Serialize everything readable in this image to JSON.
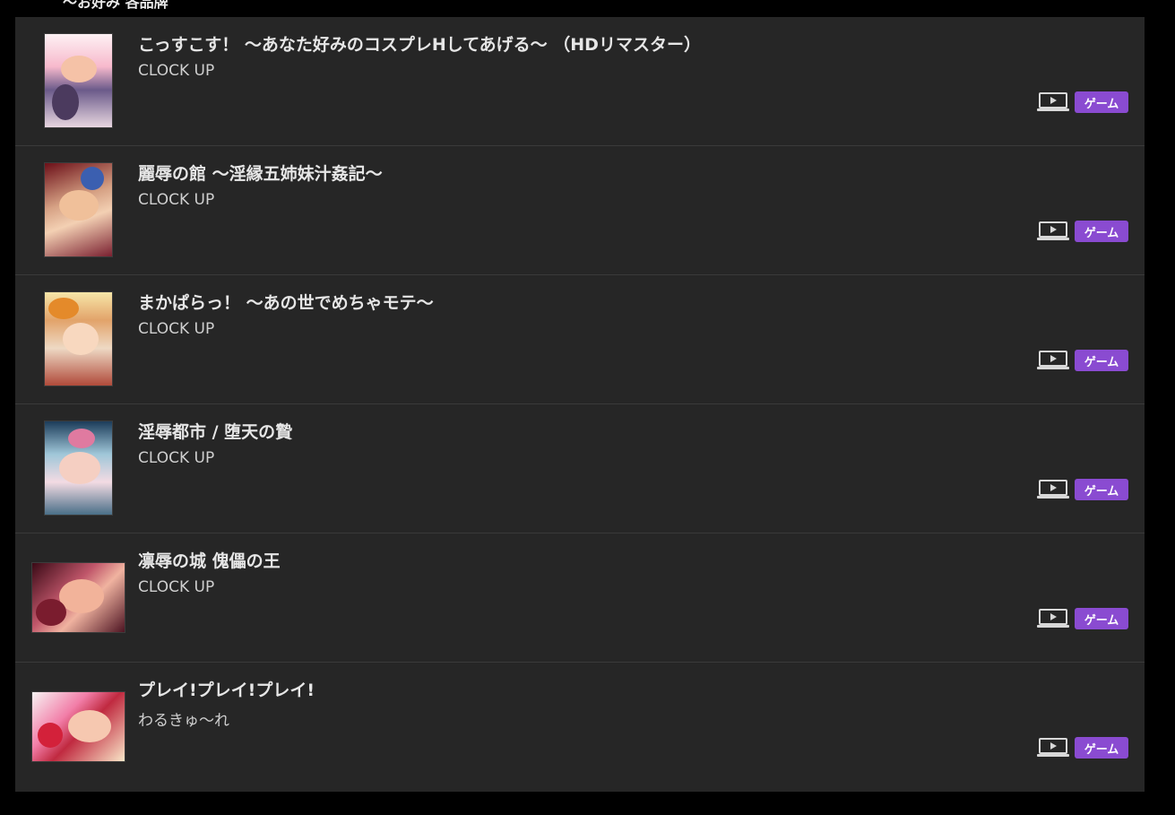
{
  "header": {
    "clipped_text": "～お好み 各品牌"
  },
  "colors": {
    "badge_bg": "#8a4bd1",
    "panel_bg": "#262626",
    "page_bg": "#000000"
  },
  "items": [
    {
      "title": "こっすこす！ ～あなた好みのコスプレHしてあげる～ （HDリマスター）",
      "maker": "CLOCK UP",
      "badge": "ゲーム",
      "icon": "video-laptop-icon"
    },
    {
      "title": "麗辱の館 ～淫縁五姉妹汁姦記～",
      "maker": "CLOCK UP",
      "badge": "ゲーム",
      "icon": "video-laptop-icon"
    },
    {
      "title": "まかぱらっ！ ～あの世でめちゃモテ～",
      "maker": "CLOCK UP",
      "badge": "ゲーム",
      "icon": "video-laptop-icon"
    },
    {
      "title": "淫辱都市 / 堕天の贄",
      "maker": "CLOCK UP",
      "badge": "ゲーム",
      "icon": "video-laptop-icon"
    },
    {
      "title": "凛辱の城 傀儡の王",
      "maker": "CLOCK UP",
      "badge": "ゲーム",
      "icon": "video-laptop-icon"
    },
    {
      "title": "プレイ!プレイ!プレイ!",
      "maker": "わるきゅ～れ",
      "badge": "ゲーム",
      "icon": "video-laptop-icon"
    }
  ]
}
